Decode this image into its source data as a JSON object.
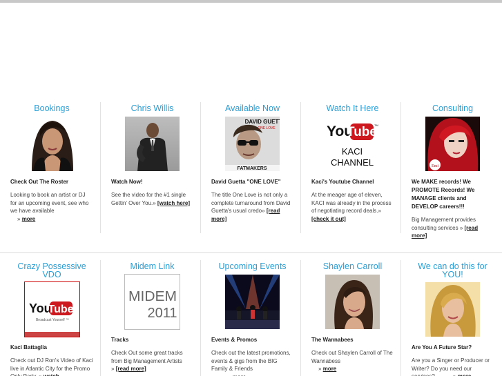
{
  "row1": [
    {
      "title": "Bookings",
      "image": "woman-portrait",
      "heading": "Check Out The Roster",
      "body": "Looking to book an artist or DJ for an upcoming event, see who we have available",
      "arrow": "»",
      "link": "more"
    },
    {
      "title": "Chris Willis",
      "image": "man-in-suit",
      "heading": "Watch Now!",
      "body": "See the video for the #1 single Gettin' Over You.",
      "arrow": "»",
      "link": "[watch here]"
    },
    {
      "title": "Available Now",
      "image": "album-cover",
      "image_text_top": "DAVID GUETTA",
      "image_text_small": "ONE LOVE",
      "image_text_bottom": "FATMAKERS",
      "heading": "David Guetta \"ONE LOVE\"",
      "body": "The title One Love is not only a complete turnaround from David Guetta's usual credo",
      "arrow": "»",
      "link": "[read more]"
    },
    {
      "title": "Watch It Here",
      "image": "youtube-logo",
      "yt_you": "You",
      "yt_tube": "Tube",
      "yt_tm": "TM",
      "channel_line1": "KACI",
      "channel_line2": "CHANNEL",
      "heading": "Kaci's Youtube Channel",
      "body": "At the meager age of eleven, KACI was already in the process of negotiating record deals.",
      "arrow": "»",
      "link": "[check it out]"
    },
    {
      "title": "Consulting",
      "image": "red-hair-portrait",
      "badge": "Emi",
      "heading": "We MAKE records! We PROMOTE Records! We MANAGE clients and DEVELOP careers!!!",
      "body": "Big Management provides consulting services",
      "arrow": "»",
      "link": "[read more]"
    }
  ],
  "row2": [
    {
      "title": "Crazy Possessive VDO",
      "image": "youtube-broadcast",
      "yt_you": "You",
      "yt_tube": "Tube",
      "yt_sub": "Broadcast Yourself ™",
      "heading": "Kaci Battaglia",
      "body": "Check out DJ Ron's Video of Kaci live in Atlantic City for the Promo Only Party.",
      "arrow": "»",
      "link": "watch"
    },
    {
      "title": "Midem Link",
      "image": "midem-logo",
      "midem_word": "MIDEM",
      "midem_year": "2011",
      "heading": "Tracks",
      "body": "Check Out some great tracks from Big Management Artists",
      "arrow": "»",
      "link": "[read more]"
    },
    {
      "title": "Upcoming Events",
      "image": "concert-stage",
      "heading": "Events & Promos",
      "body": "Check out the latest promotions, events & gigs from the BIG Family & Friends",
      "arrow": "»",
      "link": "more"
    },
    {
      "title": "Shaylen Carroll",
      "image": "smiling-woman",
      "heading": "The Wannabees",
      "body": "Check out Shaylen Carroll of The Wannabess",
      "arrow": "»",
      "link": "more"
    },
    {
      "title": "We can do this for YOU!",
      "image": "blonde-portrait",
      "heading": "Are You A Future Star?",
      "body": "Are you a Singer or Producer or Writer? Do you need our services?",
      "arrow": "»",
      "link": "more"
    }
  ],
  "colors": {
    "title_blue": "#2a9fd6",
    "divider": "#e2e2e2",
    "youtube_red": "#cc181e"
  }
}
